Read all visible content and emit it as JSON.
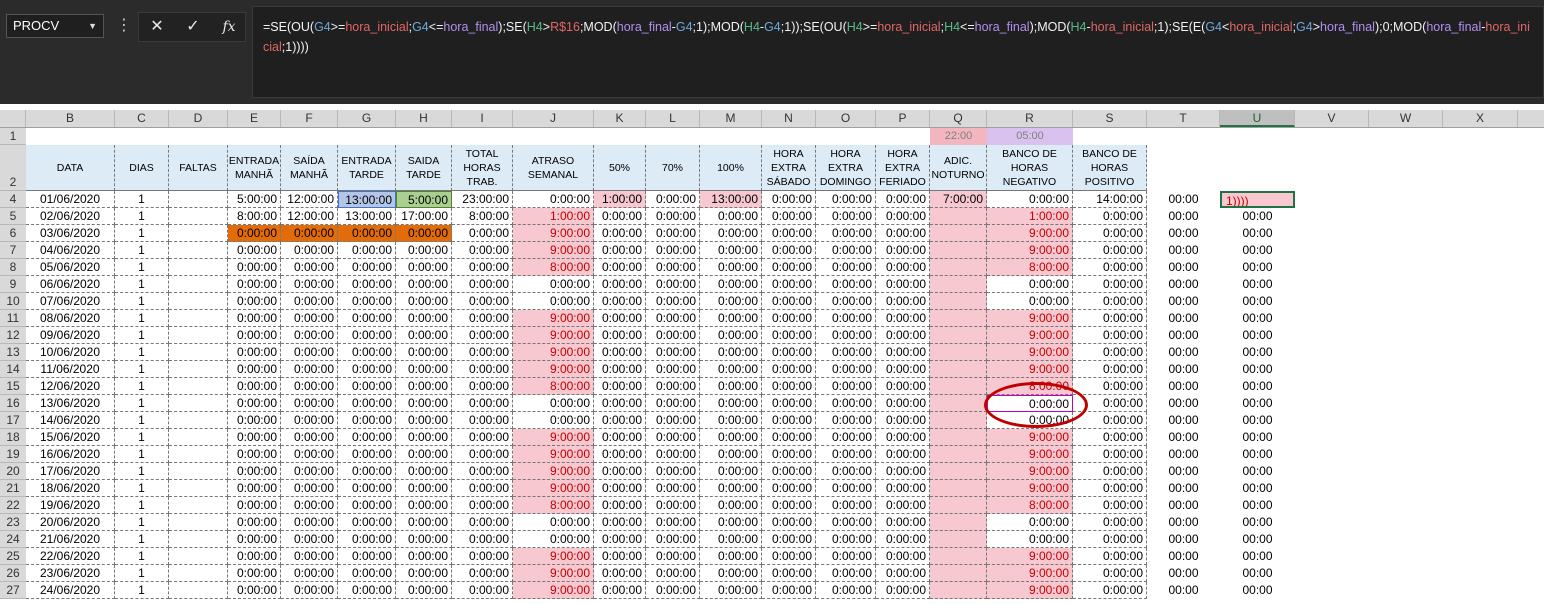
{
  "name_box": {
    "value": "PROCV"
  },
  "formula_bar": {
    "icons": [
      "cancel-icon",
      "enter-icon",
      "insert-function-icon"
    ],
    "formula_segments": [
      {
        "t": "=SE(OU(",
        "c": "#f2f2f2"
      },
      {
        "t": "G4",
        "c": "#6fa8dc"
      },
      {
        "t": ">=",
        "c": "#f2f2f2"
      },
      {
        "t": "hora_inicial",
        "c": "#e06666"
      },
      {
        "t": ";",
        "c": "#f2f2f2"
      },
      {
        "t": "G4",
        "c": "#6fa8dc"
      },
      {
        "t": "<=",
        "c": "#f2f2f2"
      },
      {
        "t": "hora_final",
        "c": "#b48ef0"
      },
      {
        "t": ");SE(",
        "c": "#f2f2f2"
      },
      {
        "t": "H4",
        "c": "#57bb8a"
      },
      {
        "t": ">",
        "c": "#f2f2f2"
      },
      {
        "t": "R$16",
        "c": "#e06666"
      },
      {
        "t": ";MOD(",
        "c": "#f2f2f2"
      },
      {
        "t": "hora_final",
        "c": "#b48ef0"
      },
      {
        "t": "-",
        "c": "#f2f2f2"
      },
      {
        "t": "G4",
        "c": "#6fa8dc"
      },
      {
        "t": ";1);MOD(",
        "c": "#f2f2f2"
      },
      {
        "t": "H4",
        "c": "#57bb8a"
      },
      {
        "t": "-",
        "c": "#f2f2f2"
      },
      {
        "t": "G4",
        "c": "#6fa8dc"
      },
      {
        "t": ";1));SE(OU(",
        "c": "#f2f2f2"
      },
      {
        "t": "H4",
        "c": "#57bb8a"
      },
      {
        "t": ">=",
        "c": "#f2f2f2"
      },
      {
        "t": "hora_inicial",
        "c": "#e06666"
      },
      {
        "t": ";",
        "c": "#f2f2f2"
      },
      {
        "t": "H4",
        "c": "#57bb8a"
      },
      {
        "t": "<=",
        "c": "#f2f2f2"
      },
      {
        "t": "hora_final",
        "c": "#b48ef0"
      },
      {
        "t": ");MOD(",
        "c": "#f2f2f2"
      },
      {
        "t": "H4",
        "c": "#57bb8a"
      },
      {
        "t": "-",
        "c": "#f2f2f2"
      },
      {
        "t": "hora_inicial",
        "c": "#e06666"
      },
      {
        "t": ";1);SE(E(",
        "c": "#f2f2f2"
      },
      {
        "t": "G4",
        "c": "#6fa8dc"
      },
      {
        "t": "<",
        "c": "#f2f2f2"
      },
      {
        "t": "hora_inicial",
        "c": "#e06666"
      },
      {
        "t": ";",
        "c": "#f2f2f2"
      },
      {
        "t": "G4",
        "c": "#6fa8dc"
      },
      {
        "t": ">",
        "c": "#f2f2f2"
      },
      {
        "t": "hora_final",
        "c": "#b48ef0"
      },
      {
        "t": ");0;MOD(",
        "c": "#f2f2f2"
      },
      {
        "t": "hora_final",
        "c": "#b48ef0"
      },
      {
        "t": "-",
        "c": "#f2f2f2"
      },
      {
        "t": "hora_inicial",
        "c": "#e06666"
      },
      {
        "t": ";1))))",
        "c": "#f2f2f2"
      }
    ]
  },
  "columns": [
    "B",
    "C",
    "D",
    "E",
    "F",
    "G",
    "H",
    "I",
    "J",
    "K",
    "L",
    "M",
    "N",
    "O",
    "P",
    "Q",
    "R",
    "S",
    "T",
    "U",
    "V",
    "W",
    "X"
  ],
  "selected_column": "U",
  "row_numbers": [
    "1",
    "2",
    "4",
    "5",
    "6",
    "7",
    "8",
    "9",
    "10",
    "11",
    "12",
    "13",
    "14",
    "15",
    "16",
    "17",
    "18",
    "19",
    "20",
    "21",
    "22",
    "23",
    "24",
    "25",
    "26",
    "27"
  ],
  "row1": {
    "Q": "22:00",
    "R": "05:00"
  },
  "headers": [
    "DATA",
    "DIAS",
    "FALTAS",
    "ENTRADA MANHÃ",
    "SAÍDA MANHÃ",
    "ENTRADA TARDE",
    "SAIDA TARDE",
    "TOTAL HORAS TRAB.",
    "ATRASO SEMANAL",
    "50%",
    "70%",
    "100%",
    "HORA EXTRA SÁBADO",
    "HORA EXTRA DOMINGO",
    "HORA EXTRA FERIADO",
    "ADIC. NOTURNO",
    "BANCO DE HORAS NEGATIVO",
    "BANCO DE HORAS POSITIVO"
  ],
  "special_rows": [
    [
      "01/06/2020",
      "1",
      "",
      "5:00:00",
      "12:00:00",
      "13:00:00",
      "5:00:00",
      "23:00:00",
      "0:00:00",
      "1:00:00",
      "0:00:00",
      "13:00:00",
      "0:00:00",
      "0:00:00",
      "0:00:00",
      "7:00:00",
      "0:00:00",
      "14:00:00",
      "00:00",
      "1))))"
    ],
    [
      "02/06/2020",
      "1",
      "",
      "8:00:00",
      "12:00:00",
      "13:00:00",
      "17:00:00",
      "8:00:00",
      "1:00:00",
      "0:00:00",
      "0:00:00",
      "0:00:00",
      "0:00:00",
      "0:00:00",
      "0:00:00",
      "",
      "1:00:00",
      "0:00:00",
      "00:00",
      "00:00"
    ]
  ],
  "rows": [
    {
      "date": "03/06/2020",
      "atraso": "9:00:00",
      "banco_neg": "9:00:00"
    },
    {
      "date": "04/06/2020",
      "atraso": "9:00:00",
      "banco_neg": "9:00:00"
    },
    {
      "date": "05/06/2020",
      "atraso": "8:00:00",
      "banco_neg": "8:00:00"
    },
    {
      "date": "06/06/2020",
      "atraso": "0:00:00",
      "banco_neg": "0:00:00"
    },
    {
      "date": "07/06/2020",
      "atraso": "0:00:00",
      "banco_neg": "0:00:00"
    },
    {
      "date": "08/06/2020",
      "atraso": "9:00:00",
      "banco_neg": "9:00:00"
    },
    {
      "date": "09/06/2020",
      "atraso": "9:00:00",
      "banco_neg": "9:00:00"
    },
    {
      "date": "10/06/2020",
      "atraso": "9:00:00",
      "banco_neg": "9:00:00"
    },
    {
      "date": "11/06/2020",
      "atraso": "9:00:00",
      "banco_neg": "9:00:00"
    },
    {
      "date": "12/06/2020",
      "atraso": "8:00:00",
      "banco_neg": "8:00:00"
    },
    {
      "date": "13/06/2020",
      "atraso": "0:00:00",
      "banco_neg": "0:00:00"
    },
    {
      "date": "14/06/2020",
      "atraso": "0:00:00",
      "banco_neg": "0:00:00"
    },
    {
      "date": "15/06/2020",
      "atraso": "9:00:00",
      "banco_neg": "9:00:00"
    },
    {
      "date": "16/06/2020",
      "atraso": "9:00:00",
      "banco_neg": "9:00:00"
    },
    {
      "date": "17/06/2020",
      "atraso": "9:00:00",
      "banco_neg": "9:00:00"
    },
    {
      "date": "18/06/2020",
      "atraso": "9:00:00",
      "banco_neg": "9:00:00"
    },
    {
      "date": "19/06/2020",
      "atraso": "8:00:00",
      "banco_neg": "8:00:00"
    },
    {
      "date": "20/06/2020",
      "atraso": "0:00:00",
      "banco_neg": "0:00:00"
    },
    {
      "date": "21/06/2020",
      "atraso": "0:00:00",
      "banco_neg": "0:00:00"
    },
    {
      "date": "22/06/2020",
      "atraso": "9:00:00",
      "banco_neg": "9:00:00"
    },
    {
      "date": "23/06/2020",
      "atraso": "9:00:00",
      "banco_neg": "9:00:00"
    },
    {
      "date": "24/06/2020",
      "atraso": "9:00:00",
      "banco_neg": "9:00:00"
    }
  ],
  "fill_values": {
    "dias": "1",
    "zero": "0:00:00",
    "tu": "00:00"
  },
  "colors": {
    "pink": "#f8c8d0",
    "orange": "#e26b0a",
    "header_blue": "#ddebf7",
    "row1_q": "#f4b6be",
    "row1_r": "#d9c2f0",
    "oval": "#c00000"
  }
}
